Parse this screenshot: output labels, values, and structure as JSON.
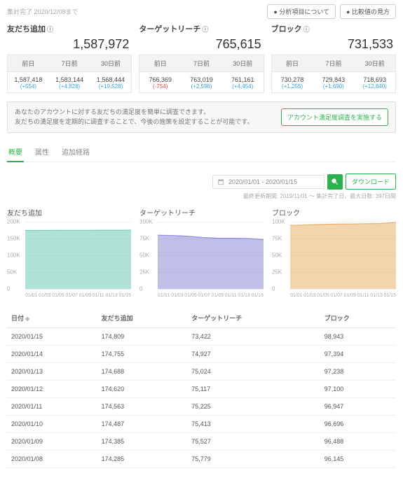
{
  "top": {
    "timestamp": "集計完了 2020/12/08まで",
    "btn_about": "分析項目について",
    "btn_compare": "比較値の見方"
  },
  "metrics": [
    {
      "title": "友だち追加",
      "big": "1,587,972",
      "periods": [
        {
          "label": "前日",
          "value": "1,587,418",
          "delta": "(+554)",
          "cls": "pos"
        },
        {
          "label": "7日前",
          "value": "1,583,144",
          "delta": "(+4,828)",
          "cls": "pos"
        },
        {
          "label": "30日前",
          "value": "1,568,444",
          "delta": "(+19,528)",
          "cls": "pos"
        }
      ]
    },
    {
      "title": "ターゲットリーチ",
      "big": "765,615",
      "periods": [
        {
          "label": "前日",
          "value": "766,369",
          "delta": "(-754)",
          "cls": "neg"
        },
        {
          "label": "7日前",
          "value": "763,019",
          "delta": "(+2,596)",
          "cls": "pos"
        },
        {
          "label": "30日前",
          "value": "761,161",
          "delta": "(+4,454)",
          "cls": "pos"
        }
      ]
    },
    {
      "title": "ブロック",
      "big": "731,533",
      "periods": [
        {
          "label": "前日",
          "value": "730,278",
          "delta": "(+1,255)",
          "cls": "pos"
        },
        {
          "label": "7日前",
          "value": "729,843",
          "delta": "(+1,690)",
          "cls": "pos"
        },
        {
          "label": "30日前",
          "value": "718,693",
          "delta": "(+12,840)",
          "cls": "pos"
        }
      ]
    }
  ],
  "notice": {
    "line1": "あなたのアカウントに対する友だちの満足度を簡単に調査できます。",
    "line2": "友だちの満足度を定期的に調査することで、今後の施策を設定することが可能です。",
    "button": "アカウント満足度調査を実施する"
  },
  "tabs": {
    "overview": "概要",
    "attr": "属性",
    "route": "追加経路"
  },
  "daterow": {
    "range": "2020/01/01 - 2020/01/15",
    "download": "ダウンロード"
  },
  "range_note": "最終更新期間: 2019/11/01 ～ 集計完了日、最大日数: 397日間",
  "chart_data": [
    {
      "type": "area",
      "title": "友だち追加",
      "color": "#6ec9b6",
      "x": [
        "01/01",
        "01/03",
        "01/05",
        "01/07",
        "01/09",
        "01/11",
        "01/13",
        "01/15"
      ],
      "yticks": [
        "0",
        "50K",
        "100K",
        "150K",
        "200K"
      ],
      "ylim": [
        0,
        200000
      ],
      "values": [
        174000,
        174100,
        174200,
        174300,
        174385,
        174487,
        174688,
        174809
      ]
    },
    {
      "type": "area",
      "title": "ターゲットリーチ",
      "color": "#8b8bd9",
      "x": [
        "01/01",
        "01/03",
        "01/05",
        "01/07",
        "01/09",
        "01/11",
        "01/13",
        "01/15"
      ],
      "yticks": [
        "0",
        "25K",
        "50K",
        "75K",
        "100K"
      ],
      "ylim": [
        0,
        100000
      ],
      "values": [
        80000,
        79500,
        78500,
        76500,
        75527,
        75413,
        75024,
        73422
      ]
    },
    {
      "type": "area",
      "title": "ブロック",
      "color": "#e8b06a",
      "x": [
        "01/01",
        "01/03",
        "01/05",
        "01/07",
        "01/09",
        "01/11",
        "01/13",
        "01/15"
      ],
      "yticks": [
        "0",
        "25K",
        "50K",
        "75K",
        "100K"
      ],
      "ylim": [
        0,
        100000
      ],
      "values": [
        94500,
        95200,
        96000,
        96488,
        96696,
        97100,
        97394,
        98943
      ]
    }
  ],
  "table": {
    "headers": {
      "date": "日付",
      "add": "友だち追加",
      "reach": "ターゲットリーチ",
      "block": "ブロック"
    },
    "rows": [
      {
        "date": "2020/01/15",
        "add": "174,809",
        "reach": "73,422",
        "block": "98,943"
      },
      {
        "date": "2020/01/14",
        "add": "174,755",
        "reach": "74,927",
        "block": "97,394"
      },
      {
        "date": "2020/01/13",
        "add": "174,688",
        "reach": "75,024",
        "block": "97,238"
      },
      {
        "date": "2020/01/12",
        "add": "174,620",
        "reach": "75,117",
        "block": "97,100"
      },
      {
        "date": "2020/01/11",
        "add": "174,563",
        "reach": "75,225",
        "block": "96,947"
      },
      {
        "date": "2020/01/10",
        "add": "174,487",
        "reach": "75,413",
        "block": "96,696"
      },
      {
        "date": "2020/01/09",
        "add": "174,385",
        "reach": "75,527",
        "block": "96,488"
      },
      {
        "date": "2020/01/08",
        "add": "174,285",
        "reach": "75,779",
        "block": "96,145"
      }
    ]
  }
}
